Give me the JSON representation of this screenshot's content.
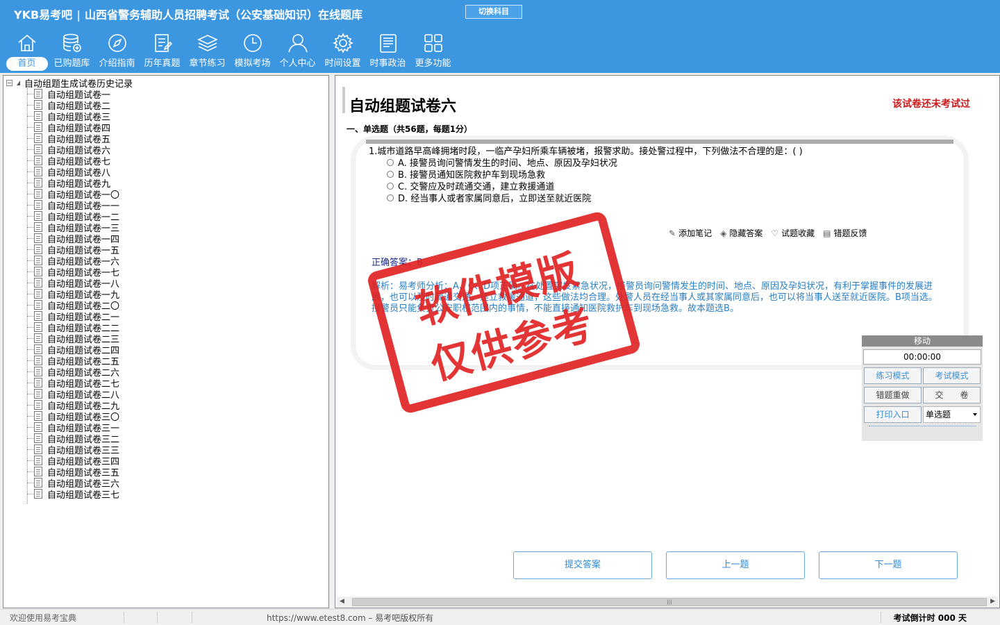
{
  "app": {
    "brand": "YKB易考吧",
    "title": "山西省警务辅助人员招聘考试（公安基础知识）在线题库",
    "switch_label": "切换科目"
  },
  "nav": [
    {
      "label": "首页",
      "icon": "home-icon",
      "active": true
    },
    {
      "label": "已购题库",
      "icon": "database-icon"
    },
    {
      "label": "介绍指南",
      "icon": "compass-icon"
    },
    {
      "label": "历年真题",
      "icon": "document-edit-icon"
    },
    {
      "label": "章节练习",
      "icon": "layers-icon"
    },
    {
      "label": "模拟考场",
      "icon": "clock-icon"
    },
    {
      "label": "个人中心",
      "icon": "user-icon"
    },
    {
      "label": "时间设置",
      "icon": "gear-icon"
    },
    {
      "label": "时事政治",
      "icon": "newspaper-icon"
    },
    {
      "label": "更多功能",
      "icon": "grid-icon"
    }
  ],
  "tree": {
    "root": "自动组题生成试卷历史记录",
    "items": [
      "自动组题试卷一",
      "自动组题试卷二",
      "自动组题试卷三",
      "自动组题试卷四",
      "自动组题试卷五",
      "自动组题试卷六",
      "自动组题试卷七",
      "自动组题试卷八",
      "自动组题试卷九",
      "自动组题试卷一〇",
      "自动组题试卷一一",
      "自动组题试卷一二",
      "自动组题试卷一三",
      "自动组题试卷一四",
      "自动组题试卷一五",
      "自动组题试卷一六",
      "自动组题试卷一七",
      "自动组题试卷一八",
      "自动组题试卷一九",
      "自动组题试卷二〇",
      "自动组题试卷二一",
      "自动组题试卷二二",
      "自动组题试卷二三",
      "自动组题试卷二四",
      "自动组题试卷二五",
      "自动组题试卷二六",
      "自动组题试卷二七",
      "自动组题试卷二八",
      "自动组题试卷二九",
      "自动组题试卷三〇",
      "自动组题试卷三一",
      "自动组题试卷三二",
      "自动组题试卷三三",
      "自动组题试卷三四",
      "自动组题试卷三五",
      "自动组题试卷三六",
      "自动组题试卷三七"
    ]
  },
  "paper": {
    "title": "自动组题试卷六",
    "status": "该试卷还未考试过",
    "section": "一、单选题（共56题，每题1分）"
  },
  "question": {
    "text": "1.城市道路早高峰拥堵时段，一临产孕妇所乘车辆被堵，报警求助。接处警过程中，下列做法不合理的是：( )",
    "options": [
      "A. 接警员询问警情发生的时间、地点、原因及孕妇状况",
      "B. 接警员通知医院救护车到现场急救",
      "C. 交警应及时疏通交通，建立救援通道",
      "D. 经当事人或者家属同意后，立即送至就近医院"
    ],
    "actions": [
      {
        "label": "添加笔记",
        "icon": "pencil-icon"
      },
      {
        "label": "隐藏答案",
        "icon": "eye-hide-icon"
      },
      {
        "label": "试题收藏",
        "icon": "heart-icon"
      },
      {
        "label": "错题反馈",
        "icon": "feedback-icon"
      }
    ],
    "answer": "正确答案：B",
    "analysis": "解析：易考师分析：A、C、D项正确。在处置突发紧急状况，接警员询问警情发生的时间、地点、原因及孕妇状况，有利于掌握事件的发展进展，也可以及时疏通交通，建立救援通道，这些做法均合理。处警人员在经当事人或其家属同意后，也可以将当事人送至就近医院。B项当选。接警员只能负责公安职权范围内的事情，不能直接通知医院救护车到现场急救。故本题选B。"
  },
  "timer": {
    "move_label": "移动",
    "time": "00:00:00",
    "practice_mode": "练习模式",
    "exam_mode": "考试模式",
    "redo_wrong": "错题重做",
    "submit_paper": "交　　卷",
    "print": "打印入口",
    "type_select": "单选题"
  },
  "buttons": {
    "submit": "提交答案",
    "prev": "上一题",
    "next": "下一题"
  },
  "watermark": {
    "line1": "软件模版",
    "line2": "仅供参考"
  },
  "statusbar": {
    "welcome": "欢迎使用易考宝典",
    "copyright": "https://www.etest8.com – 易考吧版权所有",
    "countdown": "考试倒计时 000 天"
  },
  "colors": {
    "header": "#3c96e0",
    "status_red": "#cc1a1a",
    "answer": "#1a2a8a",
    "analysis": "#2a7fc4"
  }
}
